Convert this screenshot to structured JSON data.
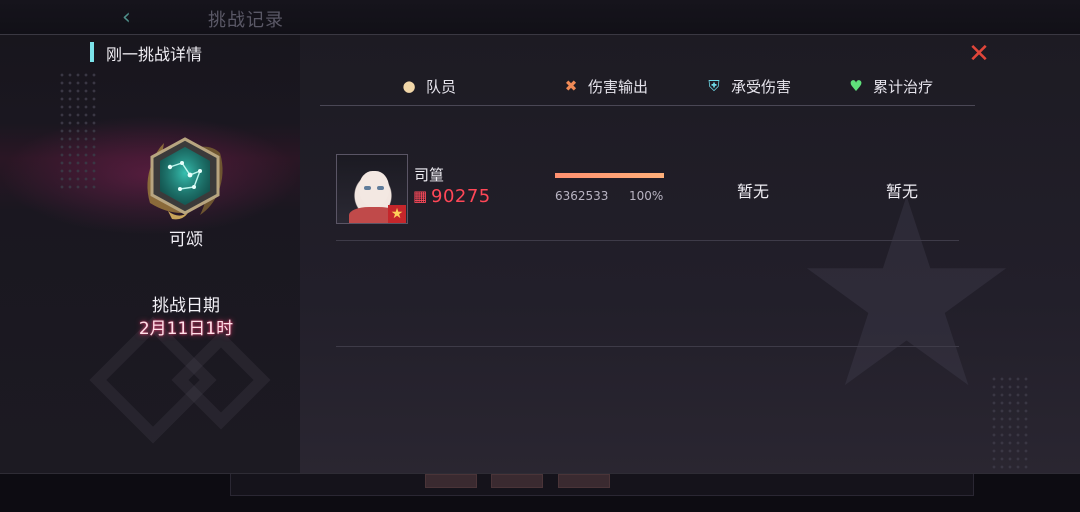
{
  "background": {
    "title": "挑战记录",
    "back_icon": "chevron-left-icon"
  },
  "modal": {
    "title": "刚一挑战详情",
    "close_icon": "close-x-icon"
  },
  "left_panel": {
    "medal_name": "可颂",
    "date_label": "挑战日期",
    "date_value": "2月11日1时"
  },
  "table": {
    "headers": [
      {
        "label": "队员",
        "icon": "person-icon",
        "color": "#f1d6a8"
      },
      {
        "label": "伤害输出",
        "icon": "crossed-swords-icon",
        "color": "#f08a56"
      },
      {
        "label": "承受伤害",
        "icon": "shield-icon",
        "color": "#6fd9e6"
      },
      {
        "label": "累计治疗",
        "icon": "heart-icon",
        "color": "#5fe07a"
      }
    ],
    "rows": [
      {
        "name": "司篁",
        "power": "90275",
        "damage_value": "6362533",
        "damage_percent": "100%",
        "damage_fraction": 1.0,
        "taken": "暂无",
        "heal": "暂无"
      }
    ]
  },
  "colors": {
    "accent_cyan": "#7be3ea",
    "close_red": "#e0463a",
    "power_red": "#ff4757",
    "damage_bar": "#ffa075",
    "date_glow": "#e63c6e"
  }
}
